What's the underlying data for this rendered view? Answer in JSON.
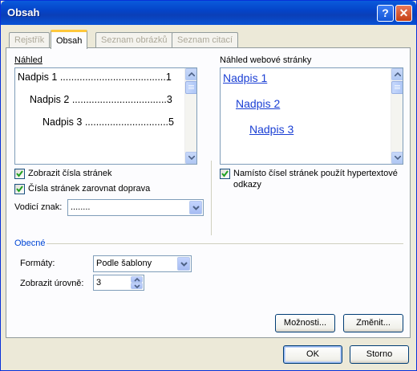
{
  "window": {
    "title": "Obsah"
  },
  "tabs": [
    {
      "label": "Rejstřík",
      "active": false
    },
    {
      "label": "Obsah",
      "active": true
    },
    {
      "label": "Seznam obrázků",
      "active": false
    },
    {
      "label": "Seznam citací",
      "active": false
    }
  ],
  "print_preview": {
    "label": "Náhled",
    "entries": [
      {
        "text": "Nadpis 1",
        "leader": "......................................",
        "page": "1"
      },
      {
        "text": "Nadpis 2",
        "leader": "..................................",
        "page": "3"
      },
      {
        "text": "Nadpis 3",
        "leader": "..............................",
        "page": "5"
      }
    ]
  },
  "web_preview": {
    "label": "Náhled webové stránky",
    "entries": [
      "Nadpis 1",
      "Nadpis 2",
      "Nadpis 3"
    ]
  },
  "options": {
    "show_page_numbers": {
      "label": "Zobrazit čísla stránek",
      "checked": true
    },
    "right_align": {
      "label": "Čísla stránek zarovnat doprava",
      "checked": true
    },
    "use_hyperlinks": {
      "label_line1": "Namísto čísel stránek použít hypertextové",
      "label_line2": "odkazy",
      "checked": true
    },
    "tab_leader": {
      "label": "Vodicí znak:",
      "value": "........"
    }
  },
  "general": {
    "title": "Obecné",
    "formats": {
      "label": "Formáty:",
      "value": "Podle šablony"
    },
    "show_levels": {
      "label": "Zobrazit úrovně:",
      "value": "3"
    }
  },
  "buttons": {
    "options": "Možnosti...",
    "modify": "Změnit...",
    "ok": "OK",
    "cancel": "Storno"
  },
  "colors": {
    "titlebar": "#0a5bdc",
    "link": "#1a3fd4",
    "group_title": "#0046d5",
    "dialog_bg": "#ece9d8"
  }
}
